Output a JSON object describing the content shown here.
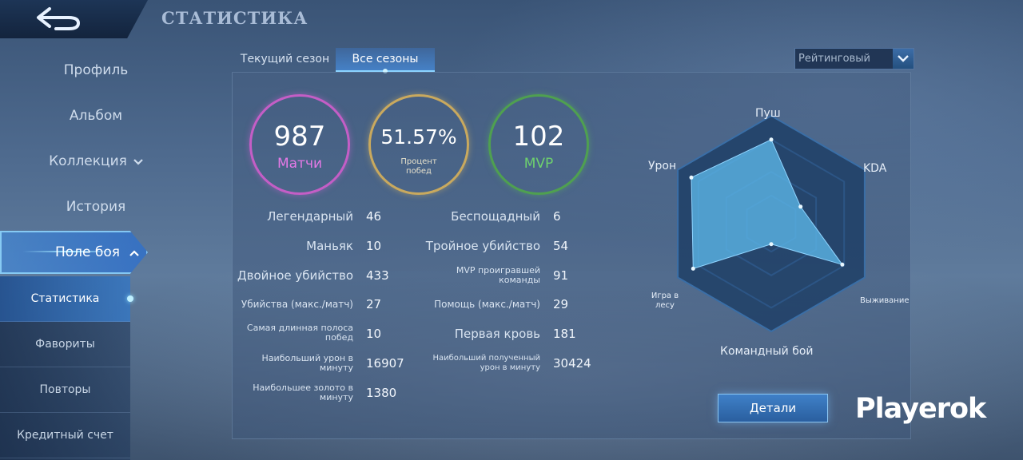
{
  "header": {
    "title": "СТАТИСТИКА",
    "back_icon": "back-arrow-icon"
  },
  "sidebar": {
    "items": [
      {
        "label": "Профиль"
      },
      {
        "label": "Альбом"
      },
      {
        "label": "Коллекция",
        "icon": "chevron-down-icon"
      },
      {
        "label": "История"
      },
      {
        "label": "Поле боя",
        "icon": "chevron-up-icon",
        "active": true
      }
    ],
    "sub_items": [
      {
        "label": "Статистика",
        "active": true
      },
      {
        "label": "Фавориты"
      },
      {
        "label": "Повторы"
      },
      {
        "label": "Кредитный счет"
      }
    ]
  },
  "tabs": [
    {
      "label": "Текущий сезон",
      "active": false
    },
    {
      "label": "Все сезоны",
      "active": true
    }
  ],
  "mode_select": {
    "value": "Рейтинговый"
  },
  "summary": {
    "matches": {
      "value": "987",
      "label": "Матчи"
    },
    "winrate": {
      "value": "51.57%",
      "label": "Процент побед"
    },
    "mvp": {
      "value": "102",
      "label": "MVP"
    }
  },
  "stats_left": [
    {
      "label": "Легендарный",
      "value": "46"
    },
    {
      "label": "Маньяк",
      "value": "10"
    },
    {
      "label": "Двойное убийство",
      "value": "433"
    },
    {
      "label": "Убийства (макс./матч)",
      "value": "27"
    },
    {
      "label": "Самая длинная полоса побед",
      "value": "10"
    },
    {
      "label": "Наибольший урон в минуту",
      "value": "16907"
    },
    {
      "label": "Наибольшее золото в минуту",
      "value": "1380"
    }
  ],
  "stats_right": [
    {
      "label": "Беспощадный",
      "value": "6"
    },
    {
      "label": "Тройное убийство",
      "value": "54"
    },
    {
      "label": "MVP проигравшей команды",
      "value": "91"
    },
    {
      "label": "Помощь (макс./матч)",
      "value": "29"
    },
    {
      "label": "Первая кровь",
      "value": "181"
    },
    {
      "label": "Наибольший полученный урон в минуту",
      "value": "30424"
    }
  ],
  "radar": {
    "labels": {
      "push": "Пуш",
      "kda": "KDA",
      "survival": "Выживание",
      "teamfight": "Командный бой",
      "jungle": "Игра в лесу",
      "damage": "Урон"
    },
    "values": {
      "push": 0.82,
      "kda": 0.33,
      "survival": 0.8,
      "teamfight": 0.2,
      "jungle": 0.88,
      "damage": 0.9
    },
    "colors": {
      "fill": "#5bb4e6",
      "outer": "#1e3f66",
      "grid": "#2c5585"
    }
  },
  "details_button": {
    "label": "Детали"
  },
  "watermark": {
    "text": "Playerok"
  }
}
